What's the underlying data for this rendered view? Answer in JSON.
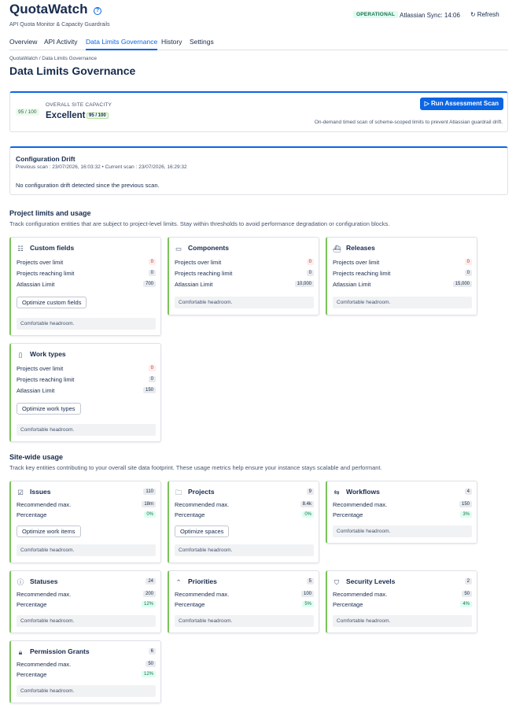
{
  "header": {
    "title": "QuotaWatch",
    "subtitle": "API Quota Monitor & Capacity Guardrails",
    "status": "OPERATIONAL",
    "sync": "Atlassian Sync: 14:06",
    "refresh_label": "Refresh",
    "help_icon": "help-icon"
  },
  "tabs": [
    "Overview",
    "API Activity",
    "Data Limits Governance",
    "History",
    "Settings"
  ],
  "active_tab": "Data Limits Governance",
  "breadcrumb": "QuotaWatch / Data Limits Governance",
  "page_title": "Data Limits Governance",
  "capacity": {
    "score": "95 / 100",
    "label": "OVERALL SITE CAPACITY",
    "value": "Excellent",
    "mini_score": "95 / 100",
    "button": "▷ Run Assessment Scan",
    "note": "On-demand timed scan of scheme-scoped limits to prevent Atlassian guardrail drift."
  },
  "drift": {
    "title": "Configuration Drift",
    "meta": "Previous scan : 23/07/2026, 16:03:32  •  Current scan : 23/07/2026, 16:29:32",
    "message": "No configuration drift detected since the previous scan."
  },
  "project_section": {
    "title": "Project limits and usage",
    "desc": "Track configuration entities that are subject to project-level limits. Stay within thresholds to avoid performance degradation or configuration blocks."
  },
  "project_cards": [
    {
      "title": "Custom fields",
      "icon": "list-icon",
      "over_label": "Projects over limit",
      "over": "0",
      "reach_label": "Projects reaching limit",
      "reach": "0",
      "limit_label": "Atlassian Limit",
      "limit": "700",
      "button": "Optimize custom fields",
      "note": "Comfortable headroom."
    },
    {
      "title": "Components",
      "icon": "box-icon",
      "over_label": "Projects over limit",
      "over": "0",
      "reach_label": "Projects reaching limit",
      "reach": "0",
      "limit_label": "Atlassian Limit",
      "limit": "10,000",
      "note": "Comfortable headroom."
    },
    {
      "title": "Releases",
      "icon": "ship-icon",
      "over_label": "Projects over limit",
      "over": "0",
      "reach_label": "Projects reaching limit",
      "reach": "0",
      "limit_label": "Atlassian Limit",
      "limit": "15,000",
      "note": "Comfortable headroom."
    },
    {
      "title": "Work types",
      "icon": "device-icon",
      "over_label": "Projects over limit",
      "over": "0",
      "reach_label": "Projects reaching limit",
      "reach": "0",
      "limit_label": "Atlassian Limit",
      "limit": "150",
      "button": "Optimize work types",
      "note": "Comfortable headroom."
    }
  ],
  "site_section": {
    "title": "Site-wide usage",
    "desc": "Track key entities contributing to your overall site data footprint. These usage metrics help ensure your instance stays scalable and performant."
  },
  "site_cards": [
    {
      "title": "Issues",
      "icon": "checkbox-icon",
      "count": "110",
      "max_label": "Recommended max.",
      "max": "18m",
      "pct_label": "Percentage",
      "pct": "0%",
      "button": "Optimize work items",
      "note": "Comfortable headroom."
    },
    {
      "title": "Projects",
      "icon": "folder-icon",
      "count": "9",
      "max_label": "Recommended max.",
      "max": "8.4k",
      "pct_label": "Percentage",
      "pct": "0%",
      "button": "Optimize spaces",
      "note": "Comfortable headroom."
    },
    {
      "title": "Workflows",
      "icon": "workflow-icon",
      "count": "4",
      "max_label": "Recommended max.",
      "max": "150",
      "pct_label": "Percentage",
      "pct": "3%",
      "note": "Comfortable headroom."
    },
    {
      "title": "Statuses",
      "icon": "info-icon",
      "count": "24",
      "max_label": "Recommended max.",
      "max": "200",
      "pct_label": "Percentage",
      "pct": "12%",
      "note": "Comfortable headroom."
    },
    {
      "title": "Priorities",
      "icon": "chevron-up-icon",
      "count": "5",
      "max_label": "Recommended max.",
      "max": "100",
      "pct_label": "Percentage",
      "pct": "5%",
      "note": "Comfortable headroom."
    },
    {
      "title": "Security Levels",
      "icon": "shield-icon",
      "count": "2",
      "max_label": "Recommended max.",
      "max": "50",
      "pct_label": "Percentage",
      "pct": "4%",
      "note": "Comfortable headroom."
    },
    {
      "title": "Permission Grants",
      "icon": "lock-icon",
      "count": "6",
      "max_label": "Recommended max.",
      "max": "50",
      "pct_label": "Percentage",
      "pct": "12%",
      "note": "Comfortable headroom."
    }
  ],
  "colors": {
    "accent": "#0c66e4",
    "success": "#7bc35b",
    "danger": "#ae2e24"
  }
}
